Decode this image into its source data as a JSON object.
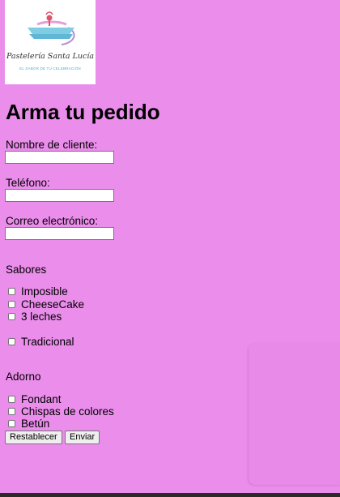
{
  "logo": {
    "name": "Pastelería Santa Lucía",
    "tagline": "EL SABOR DE TU CELEBRACIÓN"
  },
  "form": {
    "title": "Arma tu pedido",
    "fields": {
      "name_label": "Nombre de cliente:",
      "name_value": "",
      "phone_label": "Teléfono:",
      "phone_value": "",
      "email_label": "Correo electrónico:",
      "email_value": ""
    },
    "flavors": {
      "heading": "Sabores",
      "options": [
        "Imposible",
        "CheeseCake",
        "3 leches",
        "Tradicional"
      ]
    },
    "decorations": {
      "heading": "Adorno",
      "options": [
        "Fondant",
        "Chispas de colores",
        "Betún"
      ]
    },
    "buttons": {
      "reset": "Restablecer",
      "submit": "Enviar"
    }
  }
}
